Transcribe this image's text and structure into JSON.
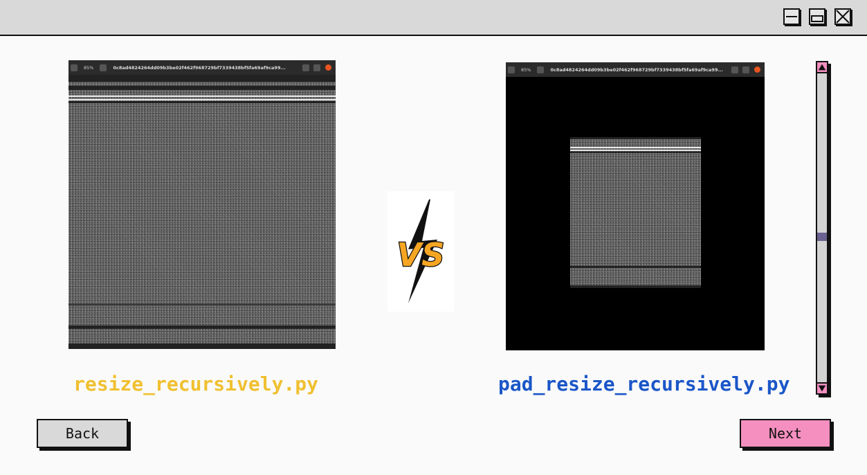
{
  "window": {
    "controls": [
      {
        "name": "minimize-icon"
      },
      {
        "name": "maximize-icon"
      },
      {
        "name": "close-icon"
      }
    ]
  },
  "left_panel": {
    "screenshot": {
      "zoom": "85%",
      "filename": "0c8ad4824264dd09b3be02f462f968729bf7339438bf5fa69af9ca99..."
    },
    "label": "resize_recursively.py",
    "label_color": "#f0c030"
  },
  "right_panel": {
    "screenshot": {
      "zoom": "85%",
      "filename": "0c8ad4824264dd09b3be02f462f968729bf7339438bf5fa69af9ca99..."
    },
    "label": "pad_resize_recursively.py",
    "label_color": "#1a56c8"
  },
  "vs_badge": {
    "text": "VS",
    "icon": "lightning-bolt-icon",
    "colors": {
      "fill": "#f6a623",
      "outline": "#111111"
    }
  },
  "scrollbar": {
    "position": 0.5,
    "arrow_color": "#f48fbf",
    "thumb_color": "#6b6291"
  },
  "buttons": {
    "back_label": "Back",
    "next_label": "Next",
    "back_color": "#d9d9d9",
    "next_color": "#f48fbf"
  }
}
